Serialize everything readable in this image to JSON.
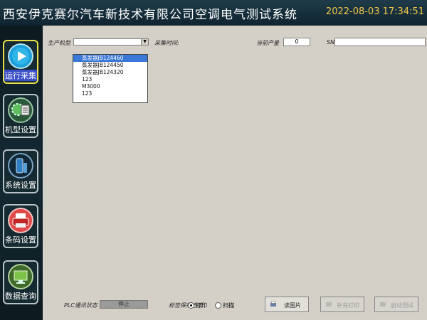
{
  "header": {
    "title": "西安伊克赛尔汽车新技术有限公司空调电气测试系统",
    "datetime": "2022-08-03  17:34:51"
  },
  "sidebar": {
    "items": [
      {
        "label": "运行采集",
        "icon": "play-icon",
        "active": true
      },
      {
        "label": "机型设置",
        "icon": "gear-document-icon"
      },
      {
        "label": "系统设置",
        "icon": "system-device-icon"
      },
      {
        "label": "条码设置",
        "icon": "printer-icon"
      },
      {
        "label": "数据查询",
        "icon": "data-monitor-icon"
      }
    ]
  },
  "form": {
    "model_label": "生产机型",
    "time_label": "采集时间:",
    "output_label": "当前产量",
    "output_value": "0",
    "sn_label": "SN",
    "sn_value": ""
  },
  "dropdown": {
    "options": [
      "蒸发器JB124460",
      "蒸发器JB124450",
      "蒸发器JB124320",
      "123",
      "M3000",
      "123"
    ],
    "selected_index": 0
  },
  "bottom": {
    "plc_label": "PLC通讯状态",
    "plc_status": "停止",
    "save_label": "标签保存方式",
    "radio_print": "打印",
    "radio_scan": "扫描",
    "read_btn": "读图片",
    "reprint_btn": "补充打印",
    "start_btn": "启动测试"
  },
  "colors": {
    "title_bar": "#15303c",
    "accent_yellow": "#e8df4a",
    "active_label": "#3a4ec8",
    "selection": "#3b79d8"
  }
}
